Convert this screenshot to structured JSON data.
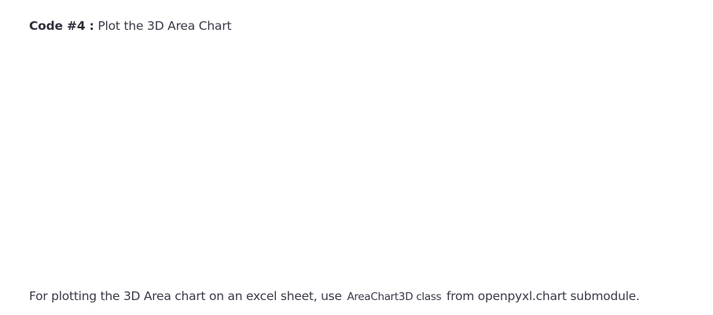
{
  "heading": {
    "label": "Code #4 :",
    "text": "Plot the 3D Area Chart"
  },
  "paragraph": {
    "before": "For plotting the 3D Area chart on an excel sheet, use",
    "code1": "AreaChart3D",
    "code2": "class",
    "after": "from openpyxl.chart submodule."
  }
}
